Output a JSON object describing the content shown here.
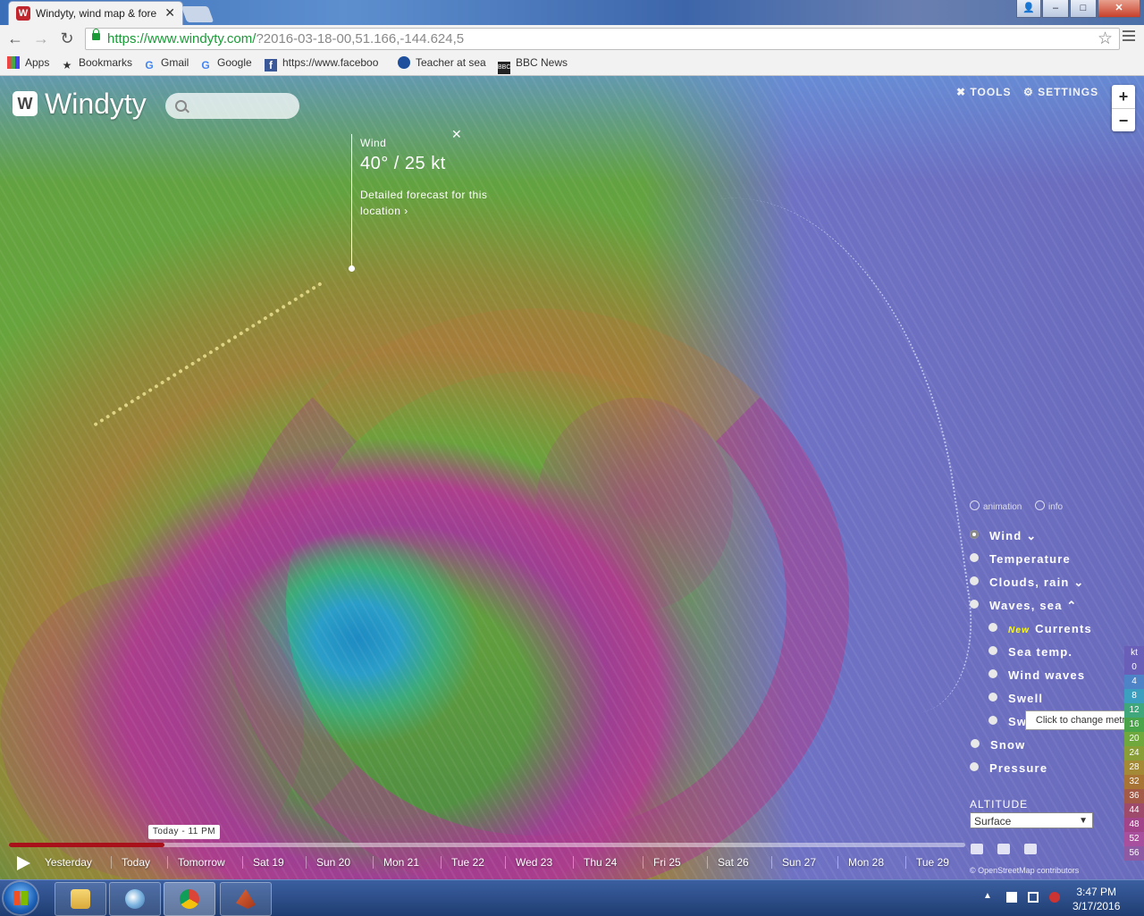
{
  "browser": {
    "tab_title": "Windyty, wind map & fore",
    "tab_favicon": "W",
    "url_main": "https://www.windyty.com/",
    "url_rest": "?2016-03-18-00,51.166,-144.624,5",
    "window_buttons": {
      "minimize": "–",
      "maximize": "□",
      "close": "✕"
    }
  },
  "bookmarks": [
    {
      "label": "Apps",
      "icon": "apps-icon"
    },
    {
      "label": "Bookmarks",
      "icon": "star-icon"
    },
    {
      "label": "Gmail",
      "icon": "google-icon"
    },
    {
      "label": "Google",
      "icon": "google-icon"
    },
    {
      "label": "https://www.faceboo",
      "icon": "facebook-icon"
    },
    {
      "label": "Teacher at sea",
      "icon": "noaa-icon"
    },
    {
      "label": "BBC News",
      "icon": "bbc-icon"
    }
  ],
  "app": {
    "logo_mark": "W",
    "logo_text": "Windyty",
    "search_placeholder": "",
    "tools_label": "TOOLS",
    "settings_label": "SETTINGS",
    "zoom_in": "+",
    "zoom_out": "−"
  },
  "popup": {
    "label": "Wind",
    "value": "40° / 25 kt",
    "more": "Detailed forecast for this location ›",
    "close": "✕"
  },
  "overlays": {
    "animation_label": "animation",
    "info_label": "info",
    "items": [
      {
        "label": "Wind ⌄",
        "selected": true
      },
      {
        "label": "Temperature"
      },
      {
        "label": "Clouds, rain ⌄"
      },
      {
        "label": "Waves, sea ⌃"
      },
      {
        "new_tag": "New",
        "label": "Currents"
      },
      {
        "label": "Sea temp."
      },
      {
        "label": "Wind waves"
      },
      {
        "label": "Swell"
      },
      {
        "label": "Sw"
      },
      {
        "label": "Snow"
      },
      {
        "label": "Pressure"
      }
    ],
    "tooltip": "Click to change metric"
  },
  "altitude": {
    "label": "ALTITUDE",
    "value": "Surface"
  },
  "legend": {
    "unit": "kt",
    "values": [
      "0",
      "4",
      "8",
      "12",
      "16",
      "20",
      "24",
      "28",
      "32",
      "36",
      "44",
      "48",
      "52",
      "56"
    ],
    "colors": [
      "#6a5fb8",
      "#4f83c7",
      "#3d9fbf",
      "#3fa77b",
      "#4aa54a",
      "#6fa83c",
      "#8a9e38",
      "#a48a36",
      "#a87436",
      "#a35a46",
      "#9e4a6a",
      "#a24489",
      "#a84f9d",
      "#8d5aa3"
    ]
  },
  "attribution": "© OpenStreetMap contributors",
  "timeline": {
    "badge": "Today - 11 PM",
    "progress": 0.163,
    "days": [
      "Yesterday",
      "Today",
      "Tomorrow",
      "Sat 19",
      "Sun 20",
      "Mon 21",
      "Tue 22",
      "Wed 23",
      "Thu 24",
      "Fri 25",
      "Sat 26",
      "Sun 27",
      "Mon 28",
      "Tue 29"
    ]
  },
  "taskbar": {
    "time": "3:47 PM",
    "date": "3/17/2016"
  }
}
